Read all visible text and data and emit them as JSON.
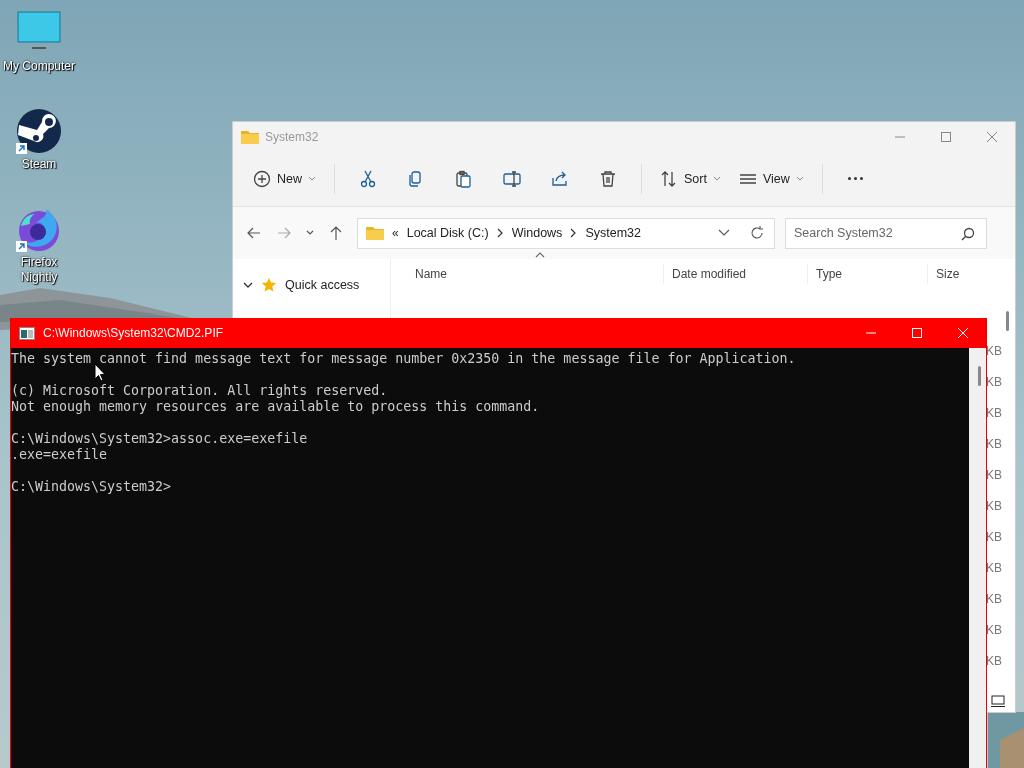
{
  "desktop": {
    "icons": [
      {
        "kind": "computer",
        "label": "My Computer",
        "shortcut": false
      },
      {
        "kind": "steam",
        "label": "Steam",
        "shortcut": true
      },
      {
        "kind": "firefox",
        "label": "Firefox Nightly",
        "shortcut": true
      }
    ]
  },
  "explorer": {
    "title": "System32",
    "toolbar": [
      {
        "kind": "new",
        "label": "New",
        "caret": true
      },
      {
        "kind": "separator"
      },
      {
        "kind": "cut"
      },
      {
        "kind": "copy"
      },
      {
        "kind": "paste"
      },
      {
        "kind": "rename"
      },
      {
        "kind": "share"
      },
      {
        "kind": "delete"
      },
      {
        "kind": "separator"
      },
      {
        "kind": "sort",
        "label": "Sort",
        "caret": true
      },
      {
        "kind": "view",
        "label": "View",
        "caret": true
      },
      {
        "kind": "separator"
      },
      {
        "kind": "more"
      }
    ],
    "address": {
      "overflow": "«",
      "crumbs": [
        "Local Disk (C:)",
        "Windows",
        "System32"
      ]
    },
    "search": {
      "placeholder": "Search System32"
    },
    "sidebar": {
      "items": [
        {
          "label": "Quick access",
          "kind": "star",
          "expanded": true
        }
      ]
    },
    "columns": [
      "Name",
      "Date modified",
      "Type",
      "Size"
    ],
    "size_fragments": [
      "KB",
      "KB",
      "KB",
      "KB",
      "KB",
      "KB",
      "KB",
      "KB",
      "KB",
      "KB",
      "KB"
    ]
  },
  "console": {
    "title": "C:\\Windows\\System32\\CMD2.PIF",
    "active": true,
    "blocks": [
      [
        "The system cannot find message text for message number 0x2350 in the message file for Application."
      ],
      [
        "(c) Microsoft Corporation. All rights reserved.",
        "Not enough memory resources are available to process this command."
      ],
      [
        "C:\\Windows\\System32>assoc.exe=exefile",
        ".exe=exefile"
      ],
      [
        "C:\\Windows\\System32>"
      ]
    ]
  }
}
